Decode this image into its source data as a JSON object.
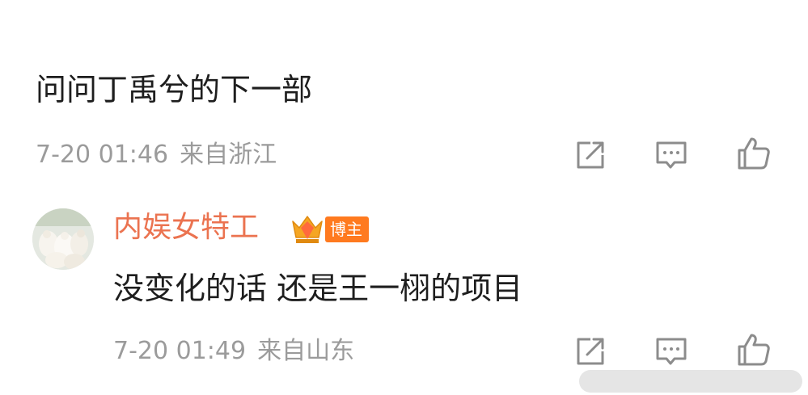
{
  "comment": {
    "text": "问问丁禹兮的下一部",
    "time": "7-20 01:46",
    "location": "来自浙江"
  },
  "reply": {
    "username": "内娱女特工",
    "badge_label": "博主",
    "text": "没变化的话 还是王一栩的项目",
    "time": "7-20 01:49",
    "location": "来自山东"
  },
  "icons": {
    "share": "share-icon",
    "reply": "comment-icon",
    "like": "thumbs-up-icon",
    "crown": "crown-badge-icon"
  },
  "colors": {
    "text": "#1e1e1e",
    "meta": "#9b9b9b",
    "username": "#eb7350",
    "badge": "#ff7a1f",
    "icon": "#8c8c8c"
  }
}
